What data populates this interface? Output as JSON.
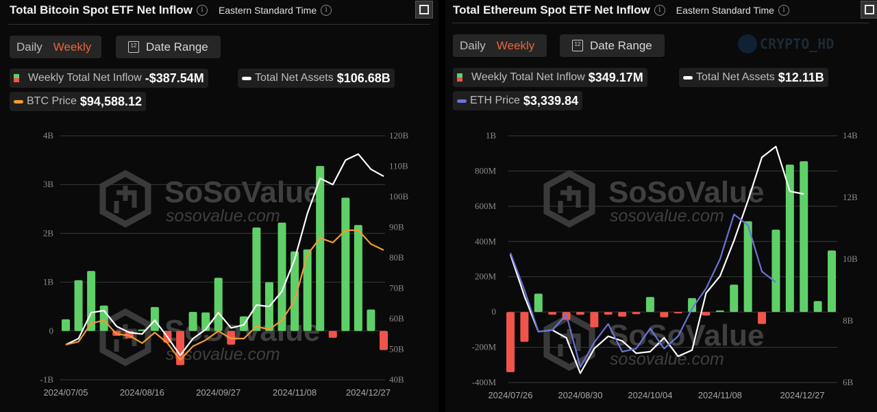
{
  "panels": [
    {
      "title": "Total Bitcoin Spot ETF Net Inflow",
      "timezone": "Eastern Standard Time",
      "period_options": [
        "Daily",
        "Weekly"
      ],
      "selected_period": "Weekly",
      "date_range_label": "Date Range",
      "calendar_icon_text": "12",
      "legend": [
        {
          "label": "Weekly Total Net Inflow",
          "value": "-$387.54M",
          "icon": "bar-swatch"
        },
        {
          "label": "Total Net Assets",
          "value": "$106.68B",
          "icon": "white-line-swatch"
        },
        {
          "label": "BTC Price",
          "value": "$94,588.12",
          "icon": "orange-line-swatch"
        }
      ],
      "watermark": {
        "brand": "SoSoValue",
        "site": "sosovalue.com"
      }
    },
    {
      "title": "Total Ethereum Spot ETF Net Inflow",
      "timezone": "Eastern Standard Time",
      "period_options": [
        "Daily",
        "Weekly"
      ],
      "selected_period": "Weekly",
      "date_range_label": "Date Range",
      "calendar_icon_text": "12",
      "legend": [
        {
          "label": "Weekly Total Net Inflow",
          "value": "$349.17M",
          "icon": "bar-swatch"
        },
        {
          "label": "Total Net Assets",
          "value": "$12.11B",
          "icon": "white-line-swatch"
        },
        {
          "label": "ETH Price",
          "value": "$3,339.84",
          "icon": "blue-line-swatch"
        }
      ],
      "watermark": {
        "brand": "SoSoValue",
        "site": "sosovalue.com"
      },
      "overlay_watermark": "CRYPTO_HD"
    }
  ],
  "colors": {
    "positive": "#5fd068",
    "negative": "#f0544a",
    "net_assets": "#ffffff",
    "btc_price": "#f39a33",
    "eth_price": "#6a74d8",
    "selected": "#e8643c"
  },
  "chart_data": [
    {
      "type": "bar",
      "title": "Total Bitcoin Spot ETF Net Inflow",
      "x_tick_labels": [
        "2024/07/05",
        "2024/08/16",
        "2024/09/27",
        "2024/11/08",
        "2024/12/27"
      ],
      "x_tick_indices": [
        0,
        6,
        12,
        18,
        25
      ],
      "y_left": {
        "ticks": [
          "4B",
          "3B",
          "2B",
          "1B",
          "0",
          "-1B"
        ],
        "range": [
          -1,
          4
        ],
        "unit": "B"
      },
      "y_right": {
        "ticks": [
          "120B",
          "110B",
          "100B",
          "90B",
          "80B",
          "70B",
          "60B",
          "50B",
          "40B"
        ],
        "range": [
          40,
          120
        ],
        "unit": "B"
      },
      "grid": true,
      "series": [
        {
          "name": "Weekly Total Net Inflow",
          "type": "bar",
          "axis": "left",
          "unit": "B USD",
          "values": [
            0.24,
            1.04,
            1.23,
            0.52,
            -0.1,
            -0.15,
            0.03,
            0.49,
            -0.24,
            -0.7,
            0.39,
            0.38,
            1.09,
            -0.28,
            0.3,
            2.12,
            1.0,
            2.22,
            1.63,
            1.67,
            3.38,
            -0.14,
            2.73,
            2.17,
            0.44,
            -0.39
          ]
        },
        {
          "name": "Total Net Assets",
          "type": "line",
          "axis": "right",
          "unit": "B USD",
          "values": [
            51.5,
            53.5,
            62.0,
            62.7,
            57.5,
            55.5,
            55.0,
            59.5,
            54.0,
            48.0,
            53.5,
            56.5,
            62.0,
            57.0,
            58.0,
            64.5,
            64.0,
            69.0,
            79.5,
            94.5,
            106.0,
            104.0,
            112.0,
            114.0,
            109.0,
            106.7
          ]
        },
        {
          "name": "BTC Price",
          "type": "line",
          "axis": "right",
          "unit": "B-scale",
          "values": [
            51.5,
            52.5,
            58.5,
            59.5,
            55.0,
            54.5,
            52.0,
            55.5,
            52.0,
            46.5,
            51.0,
            53.0,
            56.0,
            53.5,
            53.5,
            57.5,
            56.5,
            59.5,
            66.0,
            81.0,
            86.5,
            85.0,
            89.0,
            89.0,
            84.5,
            82.5
          ]
        }
      ]
    },
    {
      "type": "bar",
      "title": "Total Ethereum Spot ETF Net Inflow",
      "x_tick_labels": [
        "2024/07/26",
        "2024/08/30",
        "2024/10/04",
        "2024/11/08",
        "2024/12/27"
      ],
      "x_tick_indices": [
        0,
        5,
        10,
        15,
        22
      ],
      "y_left": {
        "ticks": [
          "1B",
          "800M",
          "600M",
          "400M",
          "200M",
          "0",
          "-200M",
          "-400M"
        ],
        "range": [
          -400,
          1000
        ],
        "unit": "M"
      },
      "y_right": {
        "ticks": [
          "14B",
          "12B",
          "10B",
          "8B",
          "6B"
        ],
        "range": [
          6,
          14
        ],
        "unit": "B"
      },
      "grid": true,
      "series": [
        {
          "name": "Weekly Total Net Inflow",
          "type": "bar",
          "axis": "left",
          "unit": "M USD",
          "values": [
            -341,
            -169,
            104,
            -15,
            -44,
            -15,
            -87,
            -15,
            -26,
            -12,
            85,
            -30,
            -3,
            79,
            -20,
            9,
            155,
            515,
            -68,
            467,
            836,
            855,
            62,
            349
          ]
        },
        {
          "name": "Total Net Assets",
          "type": "line",
          "axis": "right",
          "unit": "B USD",
          "values": [
            10.15,
            8.8,
            7.65,
            7.7,
            7.45,
            6.3,
            7.1,
            7.5,
            7.35,
            6.95,
            7.0,
            7.45,
            6.85,
            7.05,
            8.9,
            9.45,
            10.6,
            11.9,
            13.3,
            13.65,
            12.2,
            12.11
          ]
        },
        {
          "name": "ETH Price",
          "type": "line",
          "axis": "right",
          "unit": "B-scale",
          "values": [
            10.2,
            9.0,
            7.65,
            7.7,
            8.2,
            6.5,
            7.3,
            7.9,
            7.0,
            7.1,
            7.75,
            7.1,
            7.5,
            8.4,
            9.05,
            10.0,
            11.45,
            11.1,
            9.6,
            9.25
          ]
        }
      ]
    }
  ]
}
